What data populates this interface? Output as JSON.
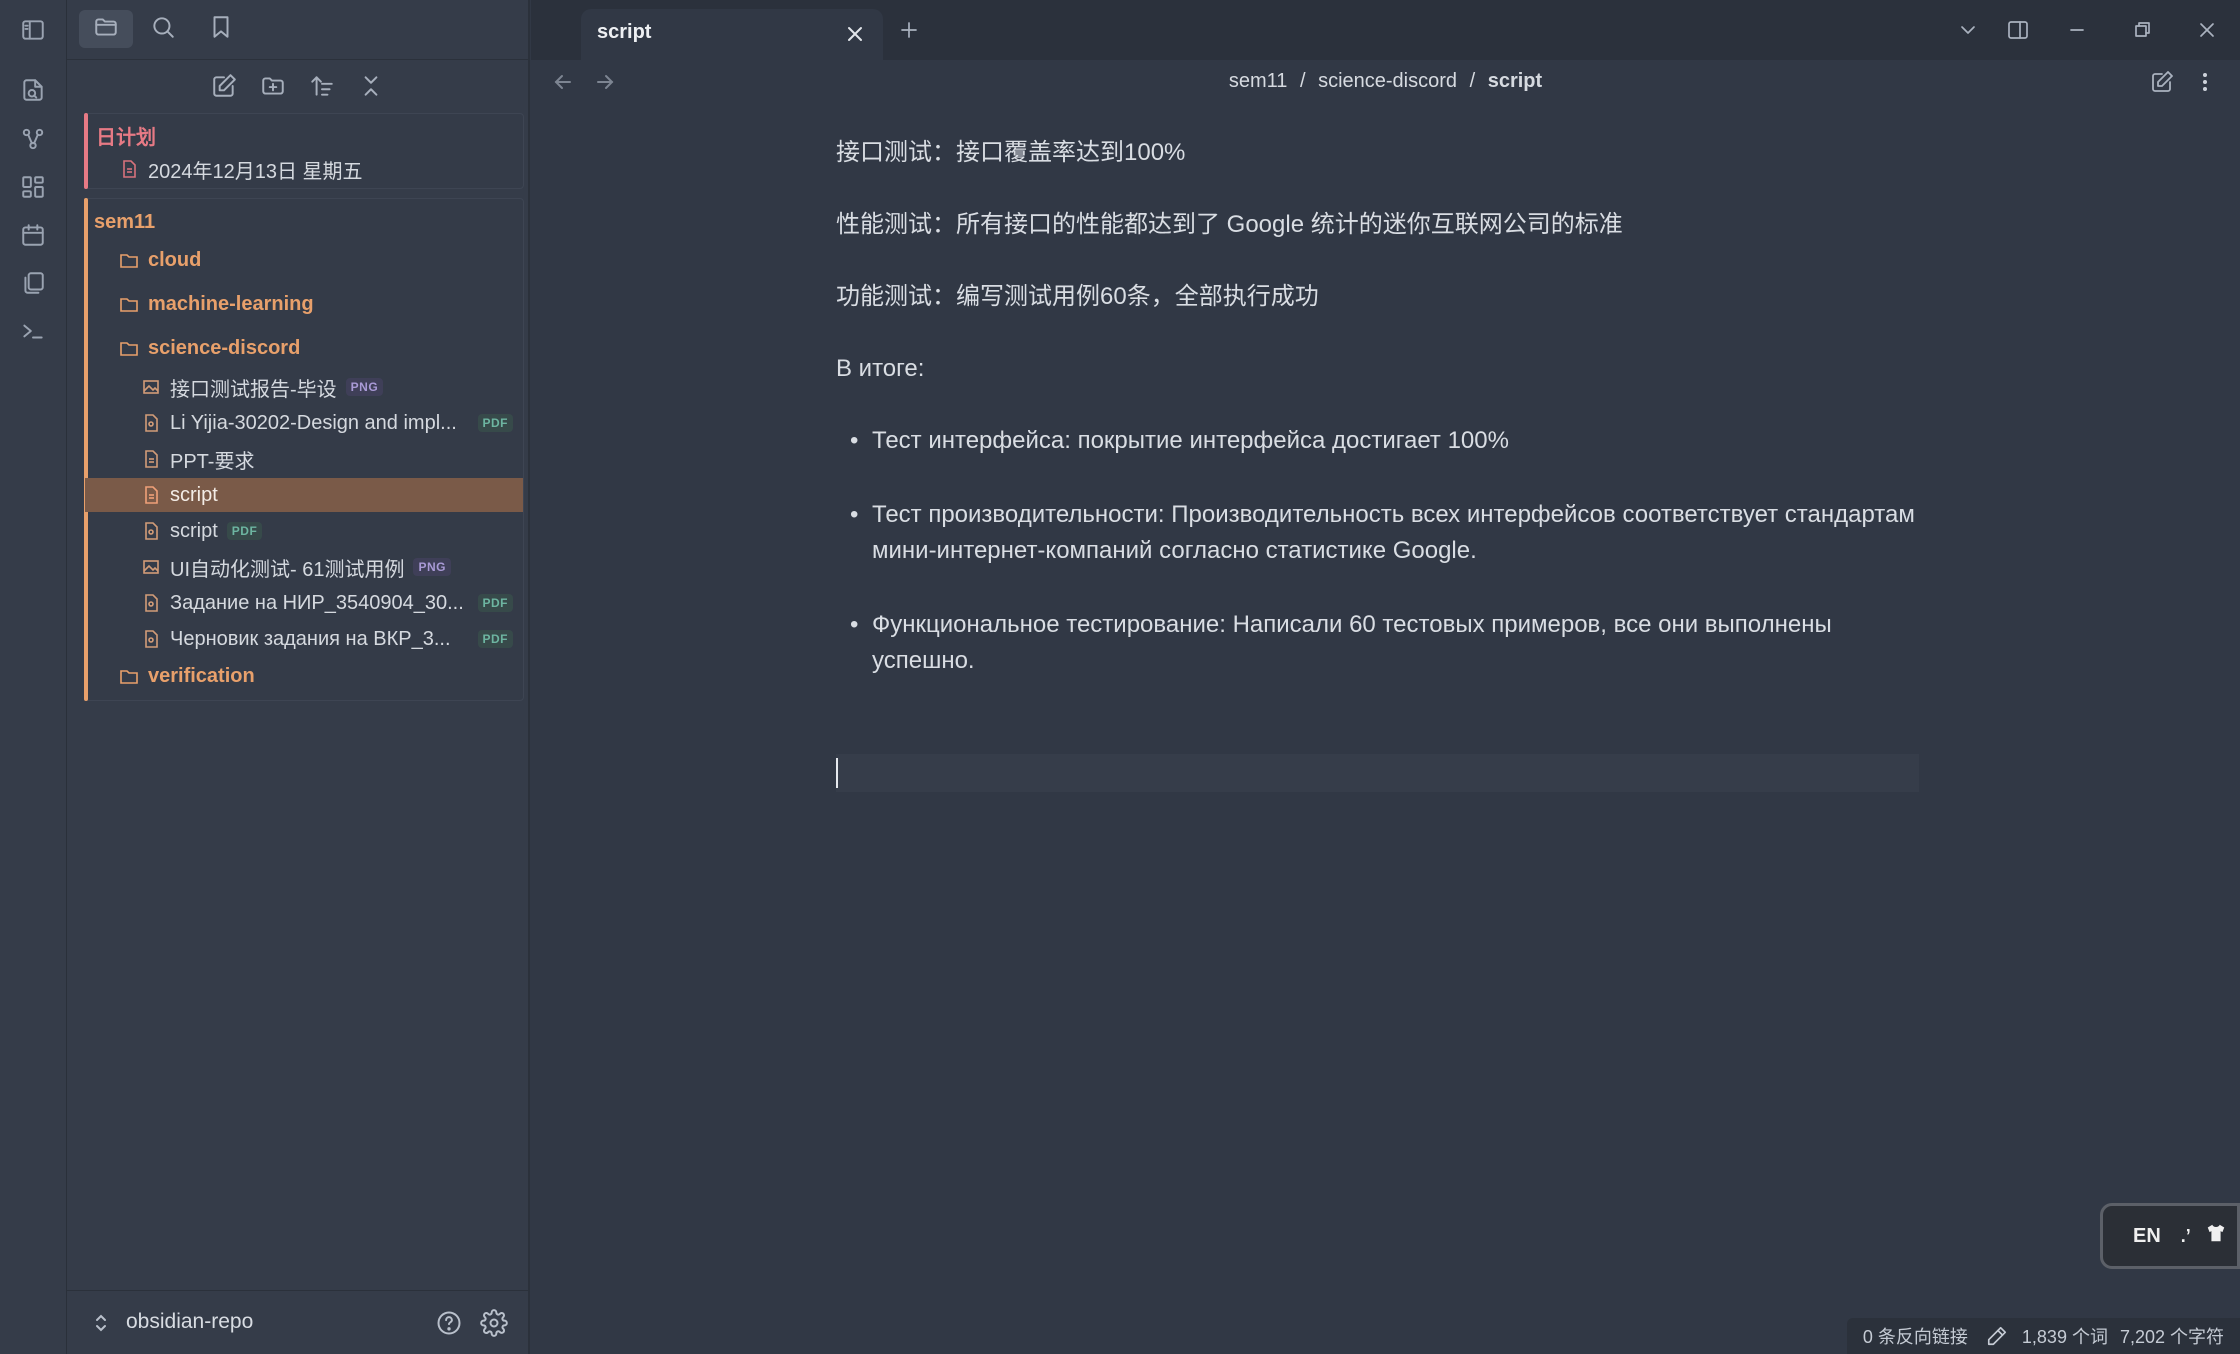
{
  "ribbon": {
    "items": [
      "toggle-sidebar",
      "open-quick-switcher",
      "graph-view",
      "canvas",
      "daily-notes",
      "templates",
      "command-palette"
    ]
  },
  "sidebar": {
    "tabs": [
      "files",
      "search",
      "bookmarks"
    ],
    "nav_actions": [
      "new-note",
      "new-folder",
      "sort",
      "collapse-all"
    ],
    "group1": {
      "title": "日计划",
      "items": [
        {
          "label": "2024年12月13日 星期五"
        }
      ]
    },
    "group2": {
      "title": "sem11",
      "folders": {
        "cloud": "cloud",
        "ml": "machine-learning",
        "sd": "science-discord",
        "verification": "verification"
      },
      "files": [
        {
          "label": "接口测试报告-毕设",
          "badge": "PNG"
        },
        {
          "label": "Li Yijia-30202-Design and impl...",
          "badge": "PDF"
        },
        {
          "label": "PPT-要求",
          "badge": ""
        },
        {
          "label": "script",
          "badge": ""
        },
        {
          "label": "script",
          "badge": "PDF"
        },
        {
          "label": "UI自动化测试- 61测试用例",
          "badge": "PNG"
        },
        {
          "label": "Задание на НИР_3540904_30...",
          "badge": "PDF"
        },
        {
          "label": "Черновик задания на ВКР_3...",
          "badge": "PDF"
        }
      ]
    },
    "vault_name": "obsidian-repo"
  },
  "tabs": [
    {
      "label": "script"
    }
  ],
  "breadcrumb": {
    "p1": "sem11",
    "sep": "/",
    "p2": "science-discord",
    "p3": "script"
  },
  "content": {
    "p1": "接口测试：接口覆盖率达到100%",
    "p2": "性能测试：所有接口的性能都达到了 Google 统计的迷你互联网公司的标准",
    "p3": "功能测试：编写测试用例60条，全部执行成功",
    "p4": "В итоге:",
    "bullets": [
      "Тест интерфейса: покрытие интерфейса достигает 100%",
      "Тест производительности: Производительность всех интерфейсов соответствует стандартам мини-интернет-компаний согласно статистике Google.",
      "Функциональное тестирование: Написали 60 тестовых примеров, все они выполнены успешно."
    ]
  },
  "status": {
    "backlinks": "0 条反向链接",
    "words": "1,839 个词",
    "chars": "7,202 个字符"
  },
  "ime": {
    "lang": "EN"
  },
  "colors": {
    "accent": "#e8a06b",
    "daily": "#e77a85",
    "selected": "#7a5a48"
  }
}
